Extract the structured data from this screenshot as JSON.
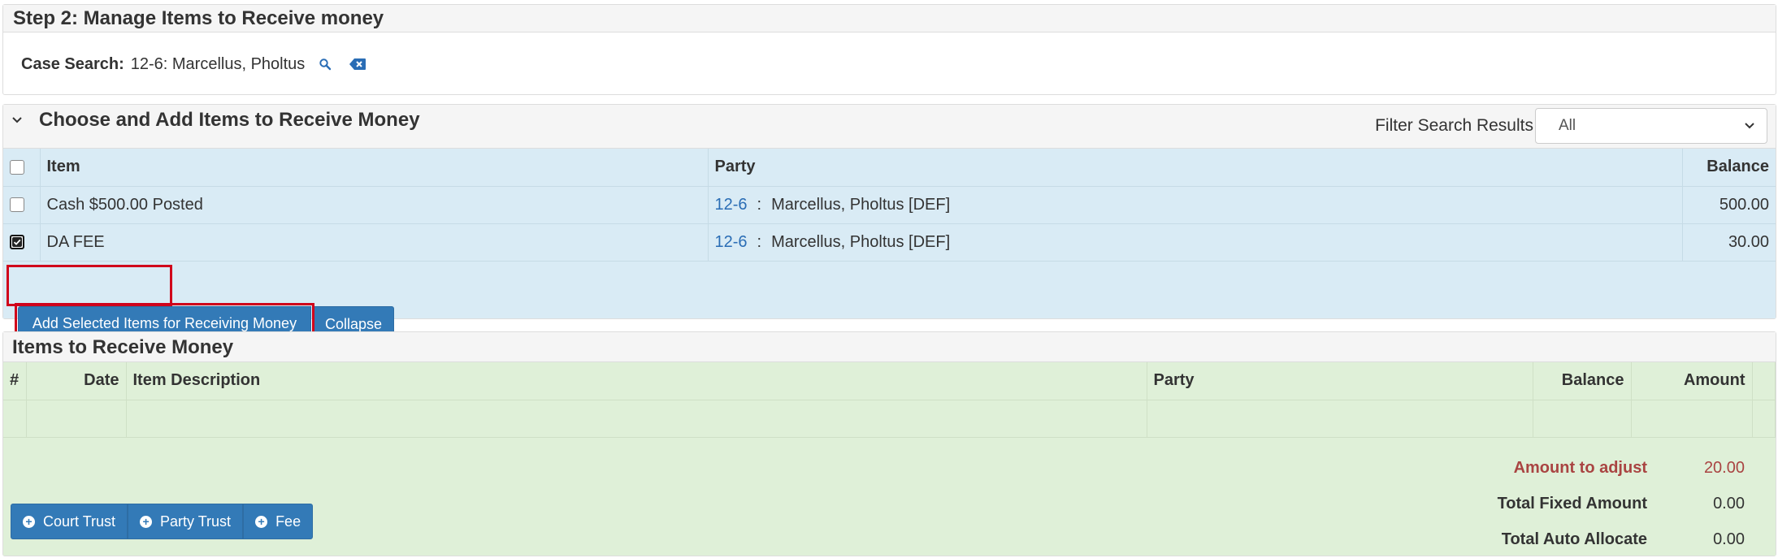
{
  "step2": {
    "title": "Step 2: Manage Items to Receive money",
    "case_search_label": "Case Search:",
    "case_search_value": "12-6: Marcellus, Pholtus",
    "search_icon": "search-icon",
    "clear_icon": "backspace-clear-icon"
  },
  "choose": {
    "title": "Choose and Add Items to Receive Money",
    "filter_label": "Filter Search Results",
    "filter_selected": "All",
    "columns": {
      "item": "Item",
      "party": "Party",
      "balance": "Balance"
    },
    "rows": [
      {
        "item": "Cash $500.00 Posted",
        "case": "12-6",
        "sep": ":",
        "party": "Marcellus, Pholtus [DEF]",
        "balance": "500.00",
        "checked": false
      },
      {
        "item": "DA FEE",
        "case": "12-6",
        "sep": ":",
        "party": "Marcellus, Pholtus [DEF]",
        "balance": "30.00",
        "checked": true
      }
    ],
    "add_selected_label": "Add Selected Items for Receiving Money",
    "collapse_label": "Collapse",
    "highlight_color": "#d0021b"
  },
  "receive": {
    "title": "Items to Receive Money",
    "columns": {
      "num": "#",
      "date": "Date",
      "description": "Item Description",
      "party": "Party",
      "balance": "Balance",
      "amount": "Amount"
    },
    "totals": {
      "adjust_label": "Amount to adjust",
      "adjust_value": "20.00",
      "fixed_label": "Total Fixed Amount",
      "fixed_value": "0.00",
      "auto_label": "Total Auto Allocate",
      "auto_value": "0.00"
    },
    "buttons": {
      "court_trust": "Court Trust",
      "party_trust": "Party Trust",
      "fee": "Fee"
    }
  },
  "colors": {
    "primary": "#337ab7",
    "blue_panel": "#d9ebf5",
    "green_panel": "#dff0d8",
    "danger_text": "#a94442"
  }
}
